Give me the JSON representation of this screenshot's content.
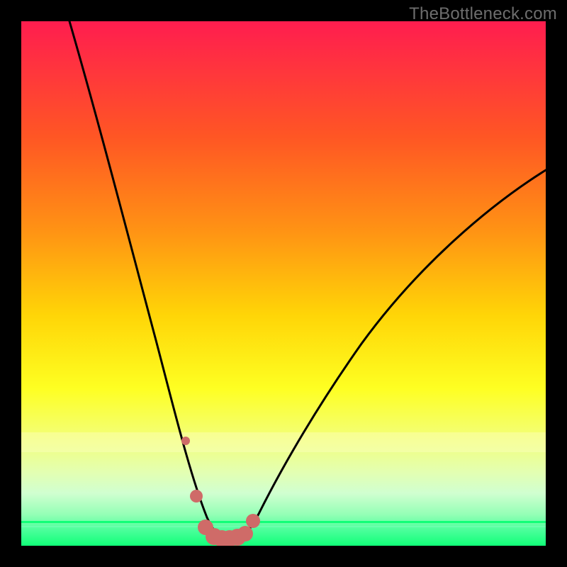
{
  "watermark": "TheBottleneck.com",
  "colors": {
    "frame": "#000000",
    "curve_stroke": "#000000",
    "marker_fill": "#cf6b68",
    "gradient_stops": [
      "#ff1d4f",
      "#ff5624",
      "#ff9314",
      "#ffd507",
      "#feff22",
      "#f2ff7d",
      "#e3ffb2",
      "#d0ffd0",
      "#95ffb6",
      "#4bff9b",
      "#11ff78"
    ]
  },
  "chart_data": {
    "type": "line",
    "title": "",
    "xlabel": "",
    "ylabel": "",
    "xlim": [
      0,
      100
    ],
    "ylim": [
      0,
      100
    ],
    "series": [
      {
        "name": "bottleneck-curve",
        "x": [
          9,
          12,
          15,
          18,
          21,
          24,
          27,
          30,
          32,
          34,
          36,
          38,
          40,
          42,
          45,
          50,
          55,
          60,
          65,
          70,
          75,
          80,
          85,
          90,
          95,
          100
        ],
        "y_pct": [
          100,
          90,
          79,
          68,
          58,
          48,
          38,
          29,
          22,
          15,
          8,
          3,
          1,
          1,
          3,
          11,
          20,
          28,
          35,
          41,
          46,
          51,
          55,
          58,
          61,
          64
        ]
      }
    ],
    "markers": {
      "name": "highlight-bottom",
      "x": [
        31,
        33,
        35,
        36.5,
        38,
        39.5,
        41,
        42.5,
        44
      ],
      "y_pct": [
        20,
        9.5,
        3.5,
        1.8,
        1.4,
        1.4,
        1.7,
        2.3,
        4.8
      ],
      "r": [
        6,
        9,
        11,
        12,
        12,
        12,
        12,
        11,
        10
      ]
    },
    "note": "y_pct is percent of plot height measured from the bottom edge; values are visual estimates read from the figure."
  }
}
